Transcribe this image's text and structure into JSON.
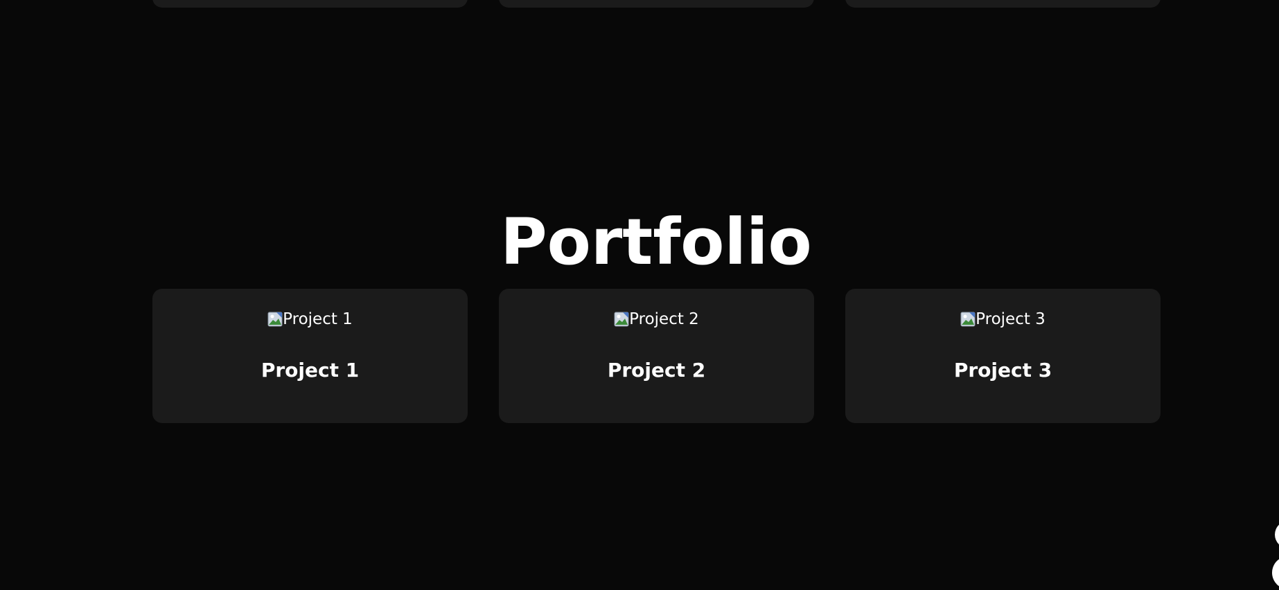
{
  "portfolio": {
    "title": "Portfolio",
    "projects": [
      {
        "image_alt": "Project 1",
        "title": "Project 1"
      },
      {
        "image_alt": "Project 2",
        "title": "Project 2"
      },
      {
        "image_alt": "Project 3",
        "title": "Project 3"
      }
    ]
  },
  "icons": {
    "image_placeholder": "broken-image-icon",
    "corner_control": "circle-button-icon"
  },
  "colors": {
    "background": "#080808",
    "card": "#1b1b1b",
    "text": "#ffffff"
  }
}
